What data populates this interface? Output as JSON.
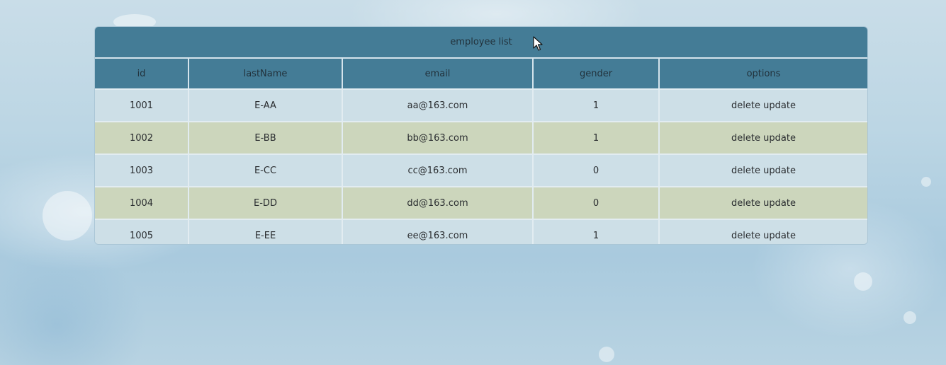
{
  "table": {
    "caption": "employee list",
    "columns": [
      "id",
      "lastName",
      "email",
      "gender",
      "options"
    ],
    "rows": [
      {
        "id": "1001",
        "lastName": "E-AA",
        "email": "aa@163.com",
        "gender": "1",
        "delete": "delete",
        "update": "update"
      },
      {
        "id": "1002",
        "lastName": "E-BB",
        "email": "bb@163.com",
        "gender": "1",
        "delete": "delete",
        "update": "update"
      },
      {
        "id": "1003",
        "lastName": "E-CC",
        "email": "cc@163.com",
        "gender": "0",
        "delete": "delete",
        "update": "update"
      },
      {
        "id": "1004",
        "lastName": "E-DD",
        "email": "dd@163.com",
        "gender": "0",
        "delete": "delete",
        "update": "update"
      },
      {
        "id": "1005",
        "lastName": "E-EE",
        "email": "ee@163.com",
        "gender": "1",
        "delete": "delete",
        "update": "update"
      }
    ]
  },
  "colors": {
    "header_bg": "#447c96",
    "row_odd_bg": "#cddfe7",
    "row_even_bg": "#ccd6bc"
  },
  "icons": {
    "cursor": "mouse-pointer-icon"
  }
}
